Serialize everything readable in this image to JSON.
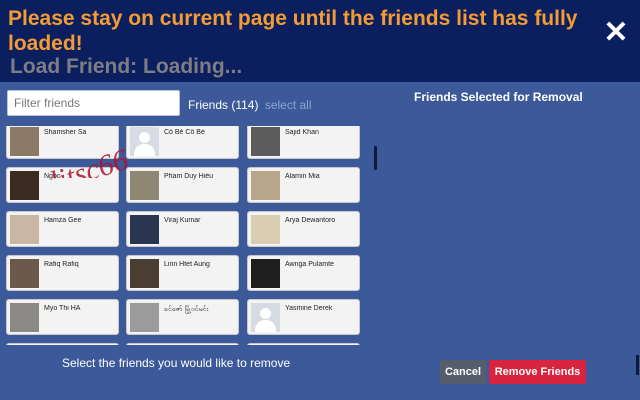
{
  "header": {
    "warning": "Please stay on current page until the friends list has fully loaded!",
    "status": "Load Friend: Loading...",
    "close_symbol": "✕"
  },
  "filter": {
    "placeholder": "Filter friends"
  },
  "friends_bar": {
    "count_label": "Friends (114)",
    "select_all": "select all"
  },
  "selected_panel": {
    "title": "Friends Selected for Removal"
  },
  "friends": [
    {
      "name": "Shamsher Sa"
    },
    {
      "name": "Cô Bé Cô Bé"
    },
    {
      "name": "Sajid Khan"
    },
    {
      "name": "Ngọc"
    },
    {
      "name": "Pham Duy Hiếu"
    },
    {
      "name": "Alamin Mia"
    },
    {
      "name": "Hamza Gee"
    },
    {
      "name": "Viraj Kumar"
    },
    {
      "name": "Arya Dewantoro"
    },
    {
      "name": "Rafiq Rafiq"
    },
    {
      "name": "Linn Htet Aung"
    },
    {
      "name": "Awnga Pulamte"
    },
    {
      "name": "Myo Thi HA"
    },
    {
      "name": "ခင်ဇော် မြို့ဝင်မင်း"
    },
    {
      "name": "Yasmine Derek"
    }
  ],
  "footer": {
    "instruction": "Select the friends you would like to remove",
    "cancel": "Cancel",
    "remove": "Remove Friends"
  },
  "watermark": "alitsc66",
  "colors": {
    "background": "#3c5a99",
    "header": "#0b1f5e",
    "warning_text": "#f39b34",
    "remove_button": "#d9243f",
    "cancel_button": "#565e6b"
  }
}
